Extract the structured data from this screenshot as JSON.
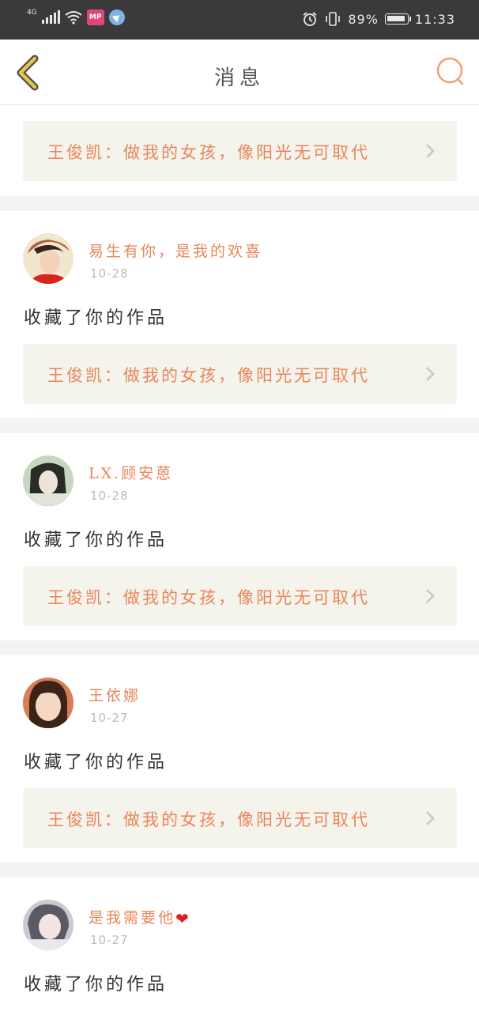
{
  "status_bar": {
    "network": "4G",
    "battery": "89%",
    "time": "11:33",
    "app_badge": "MP",
    "icons": [
      "signal-icon",
      "wifi-icon",
      "mp-app-icon",
      "location-app-icon",
      "alarm-icon",
      "vibrate-icon",
      "battery-icon"
    ]
  },
  "nav": {
    "title": "消息",
    "back_icon": "chevron-left-icon",
    "search_icon": "search-icon",
    "accent": "#f0a070",
    "back_color": "#e6c54a"
  },
  "work_title": "王俊凯：做我的女孩，像阳光无可取代",
  "messages": [
    {
      "user": "易生有你，是我的欢喜",
      "date": "10-28",
      "action": "收藏了你的作品",
      "work": "王俊凯：做我的女孩，像阳光无可取代"
    },
    {
      "user": "LX.顾安蒽",
      "date": "10-28",
      "action": "收藏了你的作品",
      "work": "王俊凯：做我的女孩，像阳光无可取代"
    },
    {
      "user": "王依娜",
      "date": "10-27",
      "action": "收藏了你的作品",
      "work": "王俊凯：做我的女孩，像阳光无可取代"
    },
    {
      "user": "是我需要他",
      "user_emoji": "❤",
      "date": "10-27",
      "action": "收藏了你的作品"
    }
  ],
  "colors": {
    "accent_text": "#e8865a",
    "card_bg": "#f4f3ec",
    "divider": "#f3f3f3",
    "status_bar": "#3a3a3a"
  }
}
